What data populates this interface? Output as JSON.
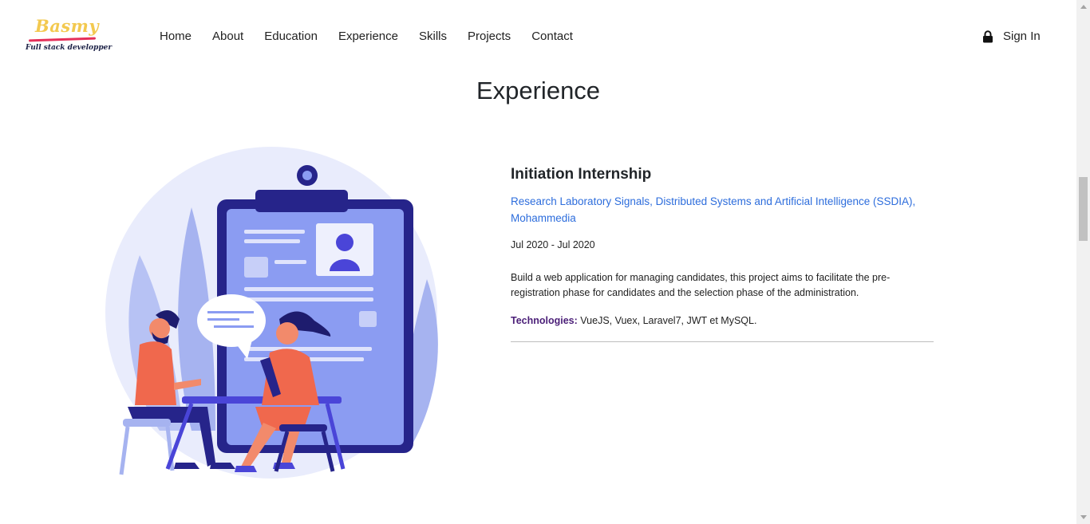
{
  "header": {
    "logo_title": "Basmy",
    "logo_subtitle": "Full stack developper",
    "nav": [
      "Home",
      "About",
      "Education",
      "Experience",
      "Skills",
      "Projects",
      "Contact"
    ],
    "signin_label": "Sign In"
  },
  "section": {
    "title": "Experience"
  },
  "experience": {
    "title": "Initiation Internship",
    "organization": "Research Laboratory Signals, Distributed Systems and Artificial Intelligence (SSDIA), Mohammedia",
    "dates": "Jul 2020 - Jul 2020",
    "description": "Build a web application for managing candidates, this project aims to facilitate the pre-registration phase for candidates and the selection phase of the administration.",
    "tech_label": "Technologies:",
    "tech_value": " VueJS, Vuex, Laravel7, JWT et MySQL."
  },
  "colors": {
    "link": "#2d6ddc",
    "tech_label": "#4b1f78",
    "logo_yellow": "#f3c94f",
    "logo_red": "#e5305a"
  },
  "icons": [
    "lock-icon",
    "scroll-up-arrow-icon",
    "scroll-down-arrow-icon"
  ]
}
